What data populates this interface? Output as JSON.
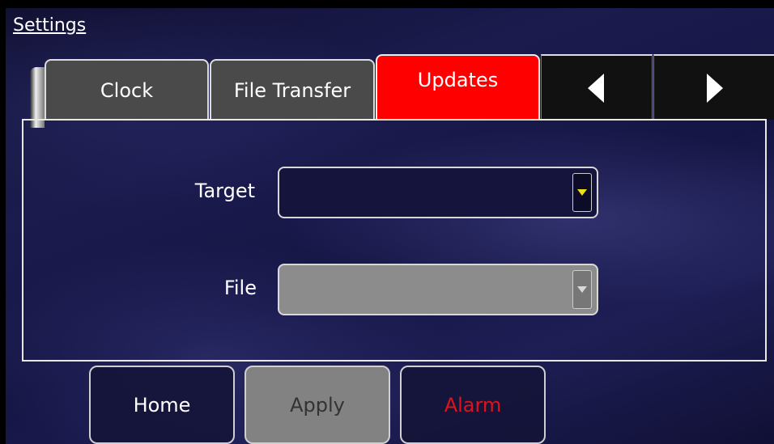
{
  "header": {
    "title": "Settings"
  },
  "tabs": [
    {
      "label": "Clock",
      "active": false
    },
    {
      "label": "File Transfer",
      "active": false
    },
    {
      "label": "Updates",
      "active": true
    }
  ],
  "nav": {
    "prev_icon": "triangle-left-icon",
    "next_icon": "triangle-right-icon"
  },
  "form": {
    "target": {
      "label": "Target",
      "value": "",
      "enabled": true
    },
    "file": {
      "label": "File",
      "value": "",
      "enabled": false
    }
  },
  "buttons": {
    "home": "Home",
    "apply": "Apply",
    "alarm": "Alarm"
  },
  "colors": {
    "active_tab": "#ff0000",
    "inactive_tab": "#4a4a4a",
    "alarm_text": "#e0121b",
    "dropdown_arrow_enabled": "#f0e010"
  }
}
